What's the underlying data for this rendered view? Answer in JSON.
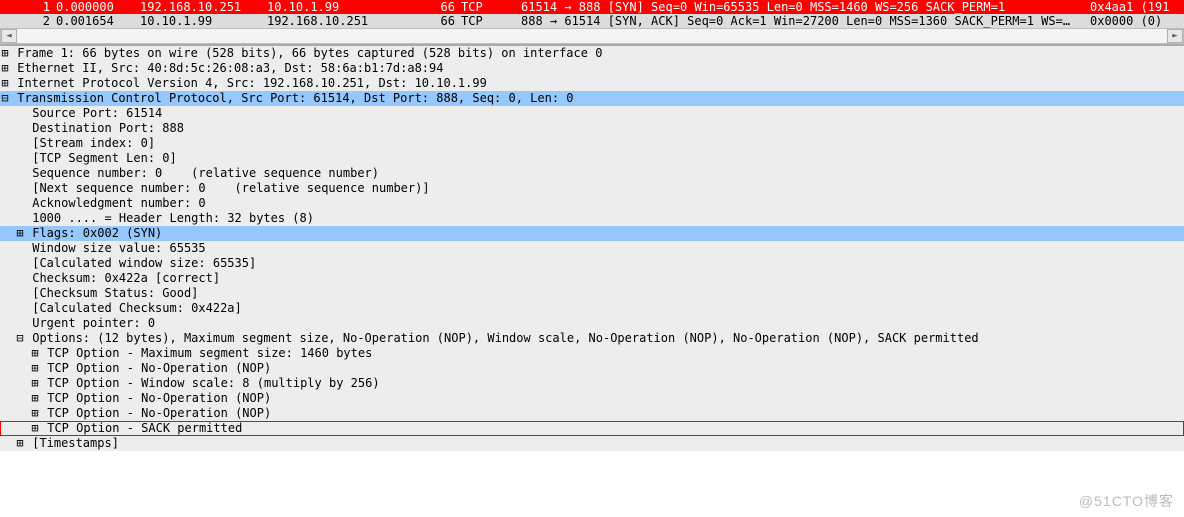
{
  "packets": [
    {
      "no": "1",
      "time": "0.000000",
      "src": "192.168.10.251",
      "dst": "10.10.1.99",
      "len": "66",
      "proto": "TCP",
      "info": "61514 → 888 [SYN] Seq=0 Win=65535 Len=0 MSS=1460 WS=256 SACK_PERM=1",
      "extra": "0x4aa1 (191",
      "selected": true
    },
    {
      "no": "2",
      "time": "0.001654",
      "src": "10.10.1.99",
      "dst": "192.168.10.251",
      "len": "66",
      "proto": "TCP",
      "info": "888 → 61514 [SYN, ACK] Seq=0 Ack=1 Win=27200 Len=0 MSS=1360 SACK_PERM=1 WS=…",
      "extra": "0x0000 (0)",
      "selected": false
    }
  ],
  "scrollbar": {
    "left_arrow": "◄",
    "right_arrow": "►"
  },
  "tree": [
    {
      "level": 0,
      "exp": "⊞",
      "text": "Frame 1: 66 bytes on wire (528 bits), 66 bytes captured (528 bits) on interface 0"
    },
    {
      "level": 0,
      "exp": "⊞",
      "text": "Ethernet II, Src: 40:8d:5c:26:08:a3, Dst: 58:6a:b1:7d:a8:94"
    },
    {
      "level": 0,
      "exp": "⊞",
      "text": "Internet Protocol Version 4, Src: 192.168.10.251, Dst: 10.10.1.99"
    },
    {
      "level": 0,
      "exp": "⊟",
      "text": "Transmission Control Protocol, Src Port: 61514, Dst Port: 888, Seq: 0, Len: 0",
      "hl": true
    },
    {
      "level": 1,
      "exp": " ",
      "text": "Source Port: 61514"
    },
    {
      "level": 1,
      "exp": " ",
      "text": "Destination Port: 888"
    },
    {
      "level": 1,
      "exp": " ",
      "text": "[Stream index: 0]"
    },
    {
      "level": 1,
      "exp": " ",
      "text": "[TCP Segment Len: 0]"
    },
    {
      "level": 1,
      "exp": " ",
      "text": "Sequence number: 0    (relative sequence number)"
    },
    {
      "level": 1,
      "exp": " ",
      "text": "[Next sequence number: 0    (relative sequence number)]"
    },
    {
      "level": 1,
      "exp": " ",
      "text": "Acknowledgment number: 0"
    },
    {
      "level": 1,
      "exp": " ",
      "text": "1000 .... = Header Length: 32 bytes (8)"
    },
    {
      "level": 1,
      "exp": "⊞",
      "text": "Flags: 0x002 (SYN)",
      "hl": true
    },
    {
      "level": 1,
      "exp": " ",
      "text": "Window size value: 65535"
    },
    {
      "level": 1,
      "exp": " ",
      "text": "[Calculated window size: 65535]"
    },
    {
      "level": 1,
      "exp": " ",
      "text": "Checksum: 0x422a [correct]"
    },
    {
      "level": 1,
      "exp": " ",
      "text": "[Checksum Status: Good]"
    },
    {
      "level": 1,
      "exp": " ",
      "text": "[Calculated Checksum: 0x422a]"
    },
    {
      "level": 1,
      "exp": " ",
      "text": "Urgent pointer: 0"
    },
    {
      "level": 1,
      "exp": "⊟",
      "text": "Options: (12 bytes), Maximum segment size, No-Operation (NOP), Window scale, No-Operation (NOP), No-Operation (NOP), SACK permitted"
    },
    {
      "level": 2,
      "exp": "⊞",
      "text": "TCP Option - Maximum segment size: 1460 bytes"
    },
    {
      "level": 2,
      "exp": "⊞",
      "text": "TCP Option - No-Operation (NOP)"
    },
    {
      "level": 2,
      "exp": "⊞",
      "text": "TCP Option - Window scale: 8 (multiply by 256)"
    },
    {
      "level": 2,
      "exp": "⊞",
      "text": "TCP Option - No-Operation (NOP)"
    },
    {
      "level": 2,
      "exp": "⊞",
      "text": "TCP Option - No-Operation (NOP)"
    },
    {
      "level": 2,
      "exp": "⊞",
      "text": "TCP Option - SACK permitted",
      "boxed": true
    },
    {
      "level": 1,
      "exp": "⊞",
      "text": "[Timestamps]"
    }
  ],
  "watermark": "@51CTO博客"
}
